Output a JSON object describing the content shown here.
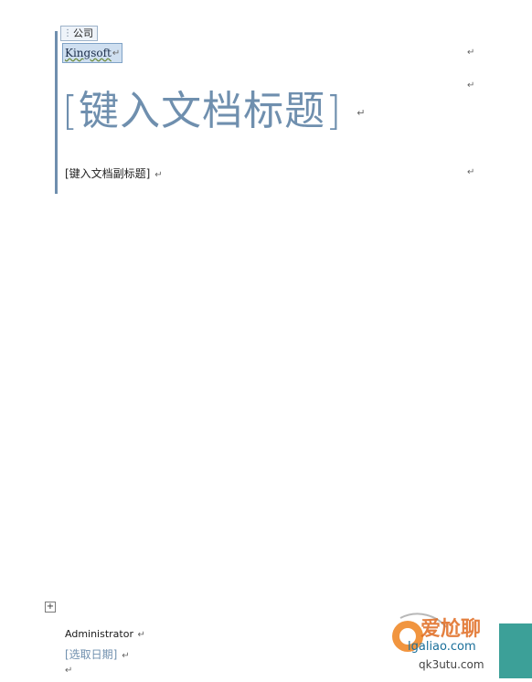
{
  "cover": {
    "company_tag": "公司",
    "company": "Kingsoft",
    "title": "[键入文档标题]",
    "subtitle": "[键入文档副标题]"
  },
  "footer": {
    "author": "Administrator",
    "date": "[选取日期]"
  },
  "marks": {
    "para": "↵",
    "expand": "+"
  },
  "watermark": {
    "line1": "爱尬聊",
    "line2": "lgaliao.com",
    "line3": "qk3utu.com"
  },
  "colors": {
    "accent": "#6f8fae",
    "selection": "#cfdff0",
    "watermark_orange": "#e06a1f",
    "watermark_teal": "#1a8f86"
  }
}
